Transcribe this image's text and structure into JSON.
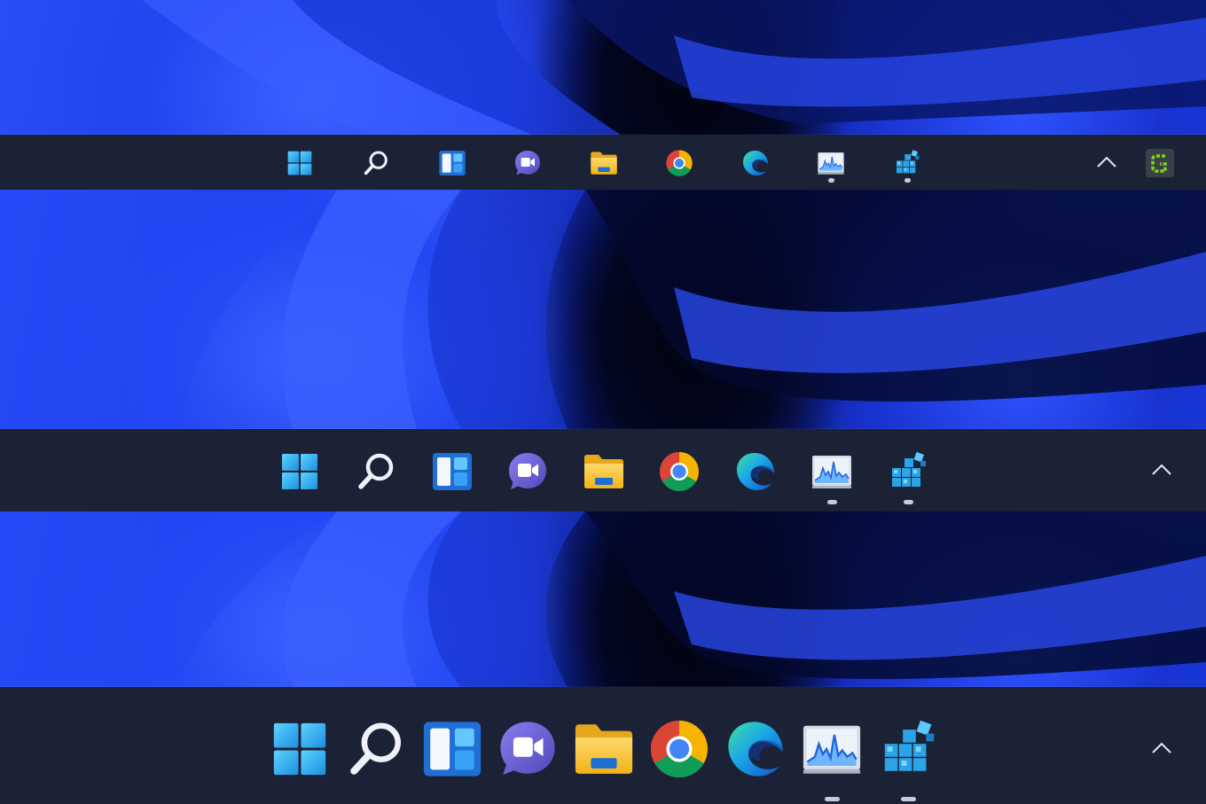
{
  "wallpaper": {
    "theme": "windows-11-bloom-blue",
    "accent": "#2a4df8"
  },
  "taskbar_color": "#1b2236",
  "taskbars": [
    {
      "size": "small",
      "pinned_icons": [
        "start-icon",
        "search-icon",
        "widgets-icon",
        "chat-icon",
        "file-explorer-icon",
        "chrome-icon",
        "edge-icon",
        "performance-monitor-icon",
        "hyper-v-icon"
      ],
      "running_indicators": [
        "performance-monitor-icon",
        "hyper-v-icon"
      ],
      "tray_icons": [
        "show-hidden-icons-chevron",
        "greenshot-tray-icon"
      ]
    },
    {
      "size": "medium",
      "pinned_icons": [
        "start-icon",
        "search-icon",
        "widgets-icon",
        "chat-icon",
        "file-explorer-icon",
        "chrome-icon",
        "edge-icon",
        "performance-monitor-icon",
        "hyper-v-icon"
      ],
      "running_indicators": [
        "performance-monitor-icon",
        "hyper-v-icon"
      ],
      "tray_icons": [
        "show-hidden-icons-chevron"
      ]
    },
    {
      "size": "large",
      "pinned_icons": [
        "start-icon",
        "search-icon",
        "widgets-icon",
        "chat-icon",
        "file-explorer-icon",
        "chrome-icon",
        "edge-icon",
        "performance-monitor-icon",
        "hyper-v-icon"
      ],
      "running_indicators": [
        "performance-monitor-icon",
        "hyper-v-icon"
      ],
      "tray_icons": [
        "show-hidden-icons-chevron"
      ]
    }
  ]
}
